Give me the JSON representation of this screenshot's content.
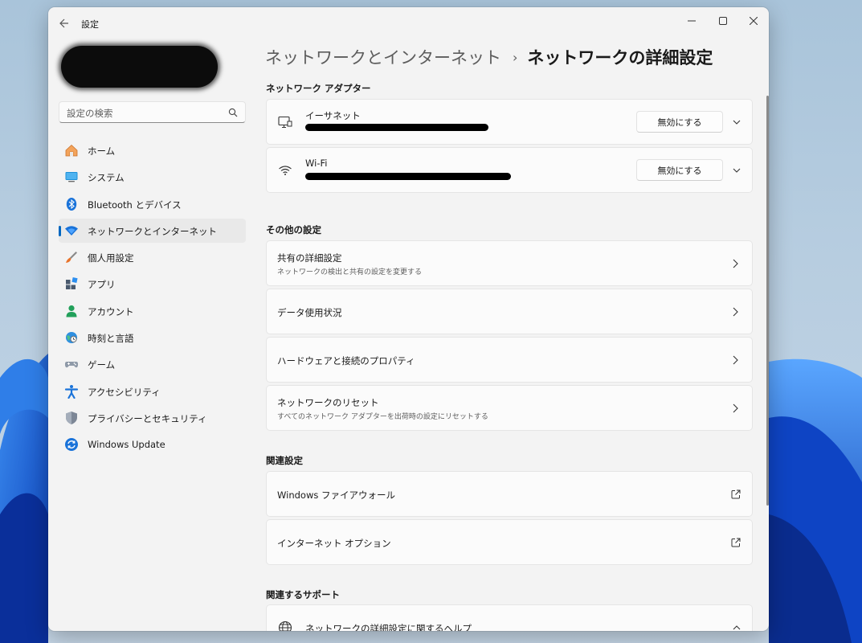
{
  "window": {
    "app_title": "設定"
  },
  "sidebar": {
    "search_placeholder": "設定の検索",
    "items": [
      {
        "label": "ホーム",
        "icon": "home-icon"
      },
      {
        "label": "システム",
        "icon": "system-icon"
      },
      {
        "label": "Bluetooth とデバイス",
        "icon": "bluetooth-icon"
      },
      {
        "label": "ネットワークとインターネット",
        "icon": "wifi-icon",
        "active": true
      },
      {
        "label": "個人用設定",
        "icon": "brush-icon"
      },
      {
        "label": "アプリ",
        "icon": "apps-icon"
      },
      {
        "label": "アカウント",
        "icon": "account-icon"
      },
      {
        "label": "時刻と言語",
        "icon": "globe-clock-icon"
      },
      {
        "label": "ゲーム",
        "icon": "gamepad-icon"
      },
      {
        "label": "アクセシビリティ",
        "icon": "accessibility-icon"
      },
      {
        "label": "プライバシーとセキュリティ",
        "icon": "shield-icon"
      },
      {
        "label": "Windows Update",
        "icon": "update-icon"
      }
    ]
  },
  "breadcrumb": {
    "parent": "ネットワークとインターネット",
    "separator": "›",
    "current": "ネットワークの詳細設定"
  },
  "adapters": {
    "section_title": "ネットワーク アダプター",
    "items": [
      {
        "name": "イーサネット",
        "button": "無効にする",
        "icon": "ethernet-icon"
      },
      {
        "name": "Wi-Fi",
        "button": "無効にする",
        "icon": "wifi-icon"
      }
    ]
  },
  "other": {
    "section_title": "その他の設定",
    "items": [
      {
        "title": "共有の詳細設定",
        "desc": "ネットワークの検出と共有の設定を変更する"
      },
      {
        "title": "データ使用状況",
        "desc": ""
      },
      {
        "title": "ハードウェアと接続のプロパティ",
        "desc": ""
      },
      {
        "title": "ネットワークのリセット",
        "desc": "すべてのネットワーク アダプターを出荷時の設定にリセットする"
      }
    ]
  },
  "related": {
    "section_title": "関連設定",
    "items": [
      {
        "title": "Windows ファイアウォール"
      },
      {
        "title": "インターネット オプション"
      }
    ]
  },
  "support": {
    "section_title": "関連するサポート",
    "items": [
      {
        "title": "ネットワークの詳細設定に関するヘルプ"
      }
    ]
  },
  "colors": {
    "accent": "#0067c0",
    "window_bg": "#f3f3f3",
    "card_bg": "#fbfbfb"
  }
}
